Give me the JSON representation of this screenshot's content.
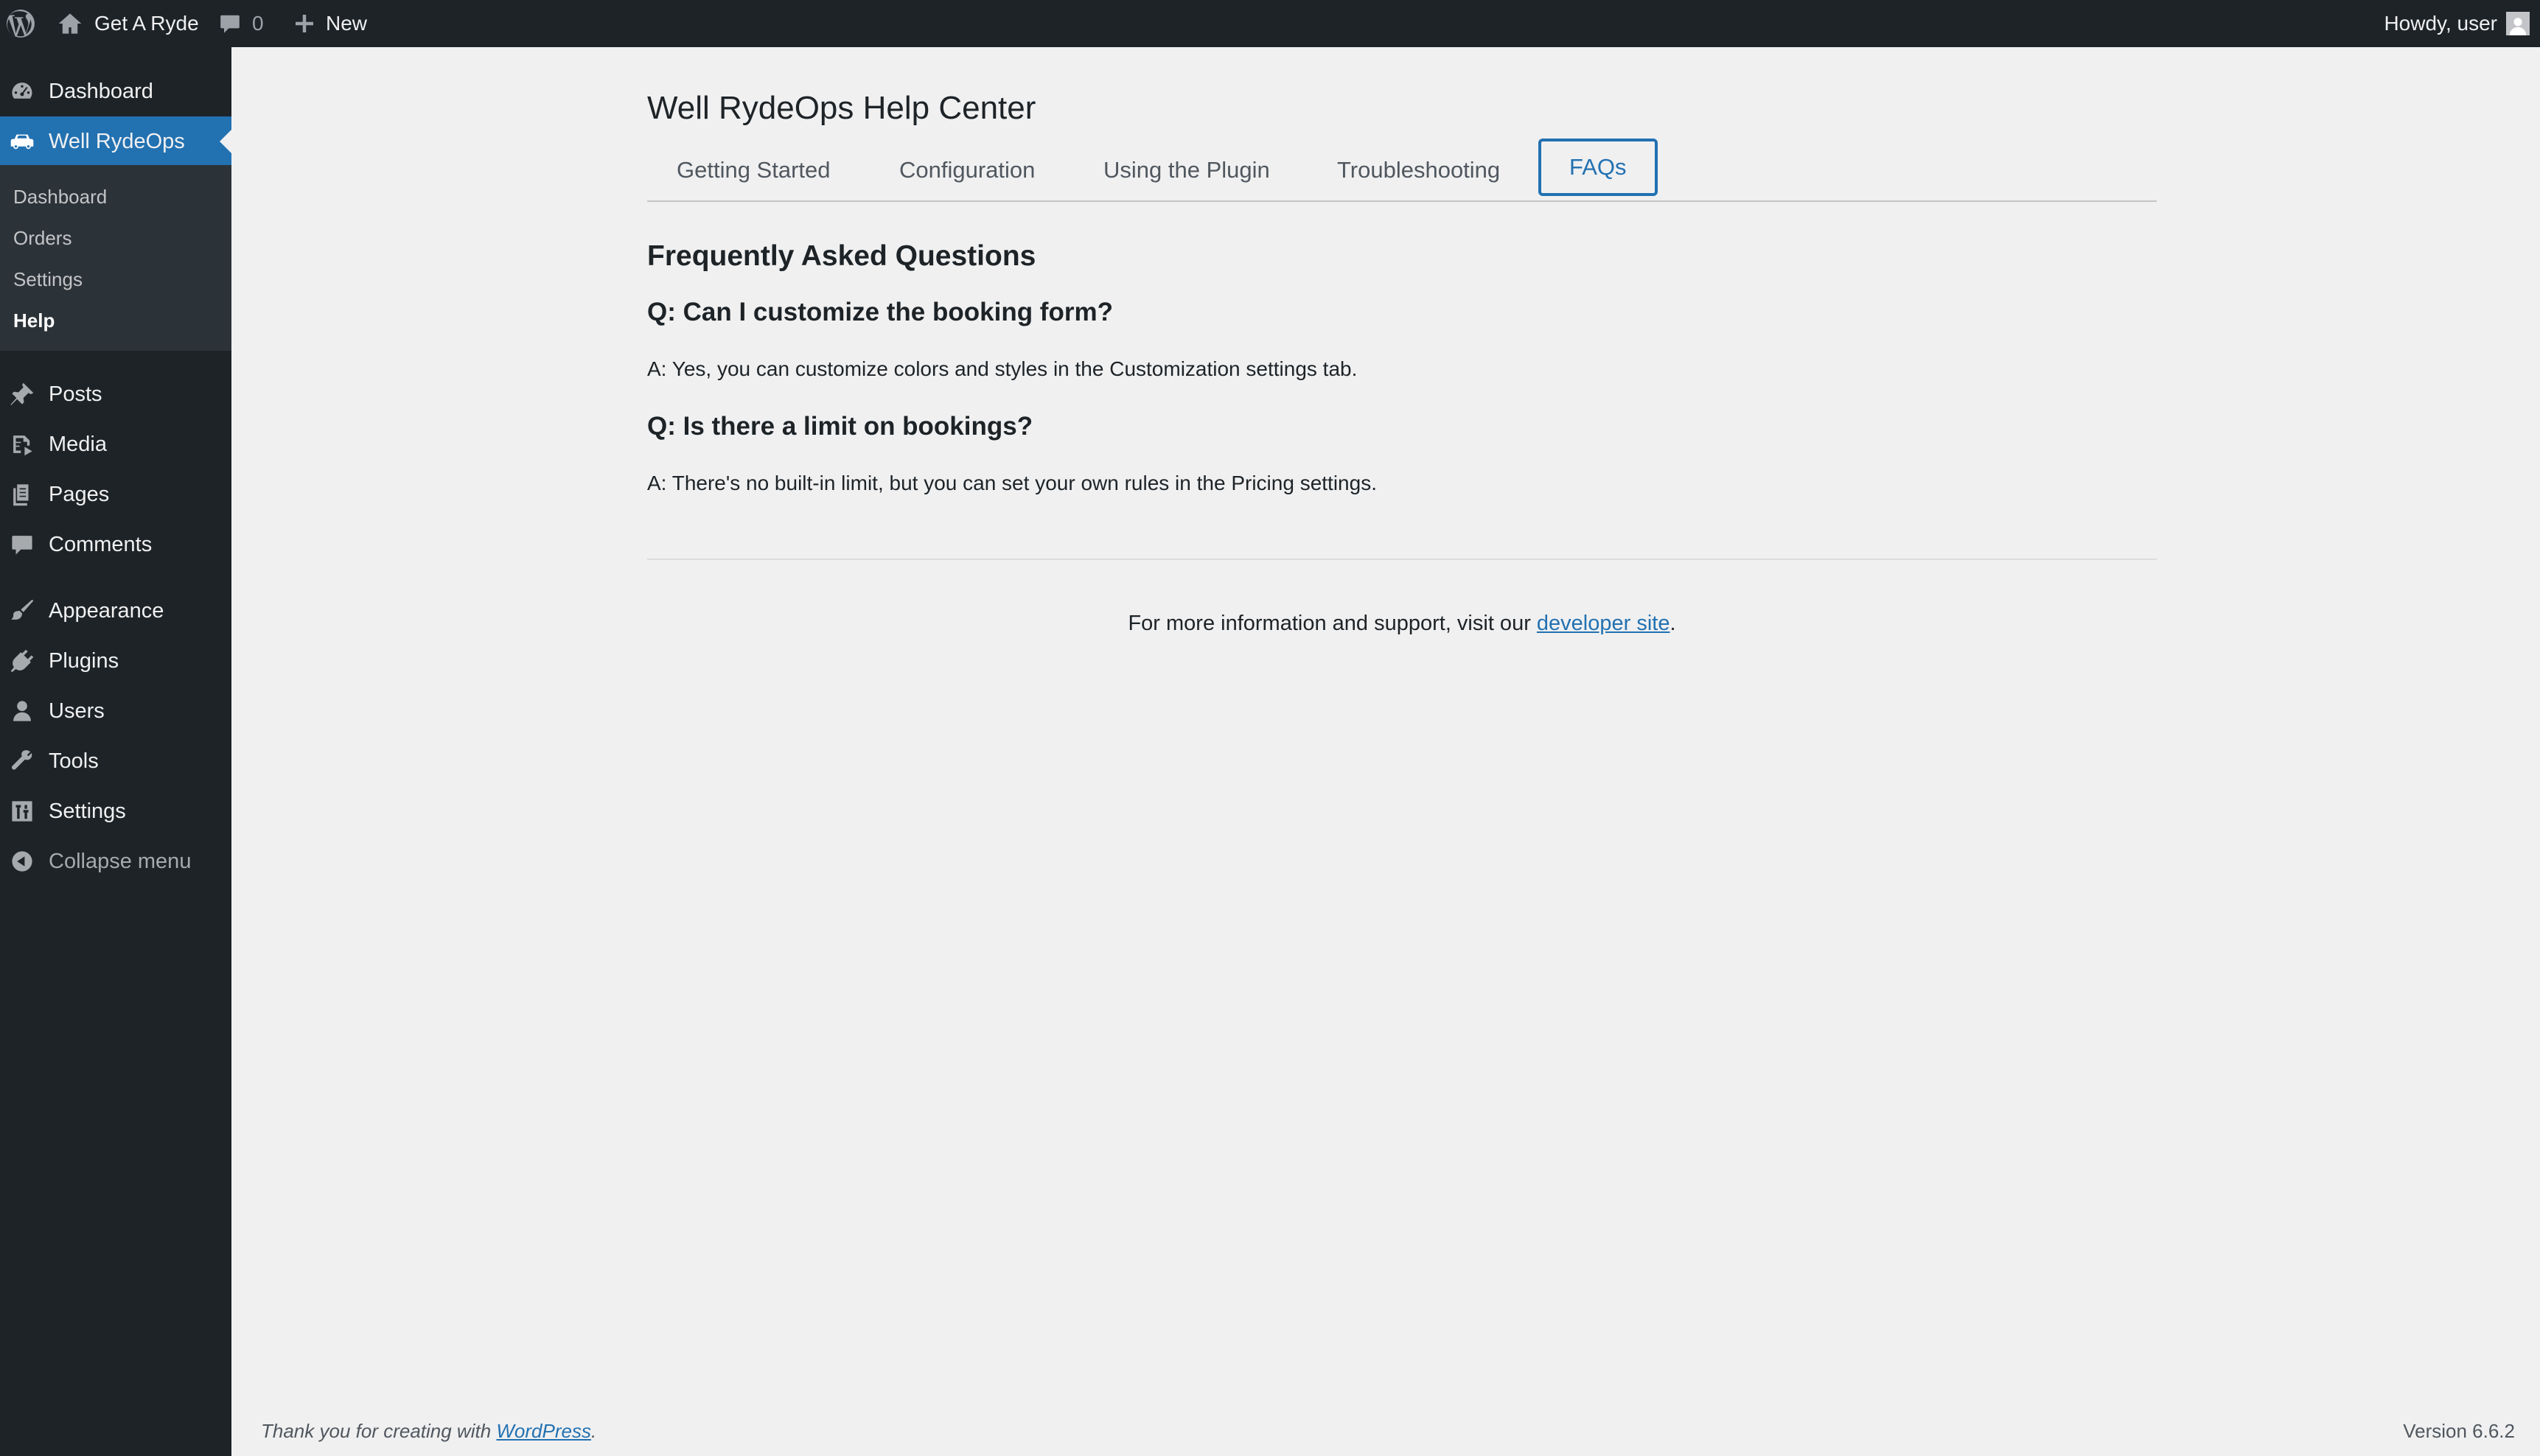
{
  "adminbar": {
    "site_name": "Get A Ryde",
    "comments_count": "0",
    "new_label": "New",
    "howdy": "Howdy, user"
  },
  "sidebar": {
    "items": [
      {
        "label": "Dashboard",
        "icon": "dashboard-icon"
      },
      {
        "label": "Well RydeOps",
        "icon": "car-icon"
      },
      {
        "label": "Posts",
        "icon": "pin-icon"
      },
      {
        "label": "Media",
        "icon": "media-icon"
      },
      {
        "label": "Pages",
        "icon": "pages-icon"
      },
      {
        "label": "Comments",
        "icon": "comment-icon"
      },
      {
        "label": "Appearance",
        "icon": "brush-icon"
      },
      {
        "label": "Plugins",
        "icon": "plugin-icon"
      },
      {
        "label": "Users",
        "icon": "user-icon"
      },
      {
        "label": "Tools",
        "icon": "wrench-icon"
      },
      {
        "label": "Settings",
        "icon": "settings-icon"
      },
      {
        "label": "Collapse menu",
        "icon": "collapse-icon"
      }
    ],
    "submenu": [
      "Dashboard",
      "Orders",
      "Settings",
      "Help"
    ]
  },
  "main": {
    "title": "Well RydeOps Help Center",
    "tabs": [
      "Getting Started",
      "Configuration",
      "Using the Plugin",
      "Troubleshooting",
      "FAQs"
    ],
    "active_tab": "FAQs",
    "faq_heading": "Frequently Asked Questions",
    "faqs": [
      {
        "q": "Q: Can I customize the booking form?",
        "a": "A: Yes, you can customize colors and styles in the Customization settings tab."
      },
      {
        "q": "Q: Is there a limit on bookings?",
        "a": "A: There's no built-in limit, but you can set your own rules in the Pricing settings."
      }
    ],
    "support_prefix": "For more information and support, visit our ",
    "support_link": "developer site",
    "support_suffix": "."
  },
  "footer": {
    "thanks_prefix": "Thank you for creating with ",
    "thanks_link": "WordPress",
    "thanks_suffix": ".",
    "version": "Version 6.6.2"
  },
  "colors": {
    "accent": "#2271b1",
    "sidebar_bg": "#1d2327",
    "page_bg": "#f0f0f1"
  }
}
